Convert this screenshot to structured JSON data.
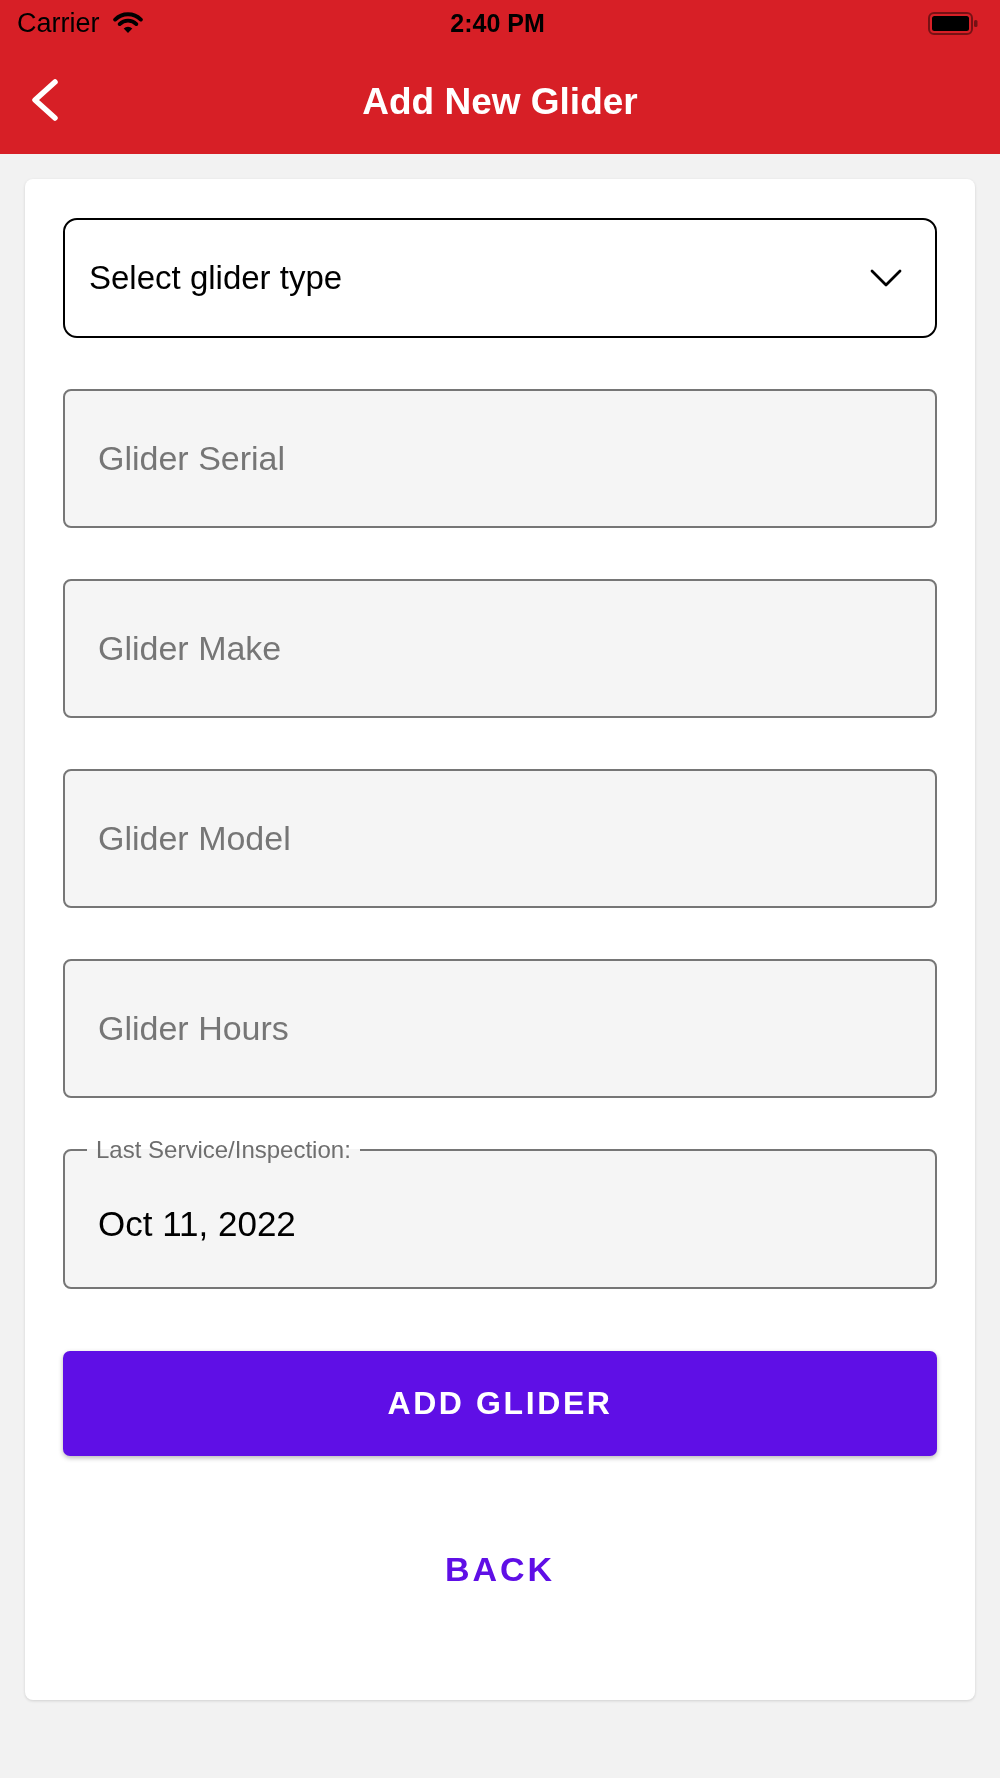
{
  "status_bar": {
    "carrier": "Carrier",
    "time": "2:40 PM"
  },
  "header": {
    "title": "Add New Glider"
  },
  "form": {
    "type_select": {
      "text": "Select glider type"
    },
    "fields": [
      {
        "placeholder": "Glider Serial"
      },
      {
        "placeholder": "Glider Make"
      },
      {
        "placeholder": "Glider Model"
      },
      {
        "placeholder": "Glider Hours"
      }
    ],
    "date_field": {
      "label": "Last Service/Inspection:",
      "value": "Oct 11, 2022"
    },
    "buttons": [
      {
        "label": "ADD GLIDER",
        "kind": "primary"
      },
      {
        "label": "BACK",
        "kind": "text"
      }
    ]
  }
}
